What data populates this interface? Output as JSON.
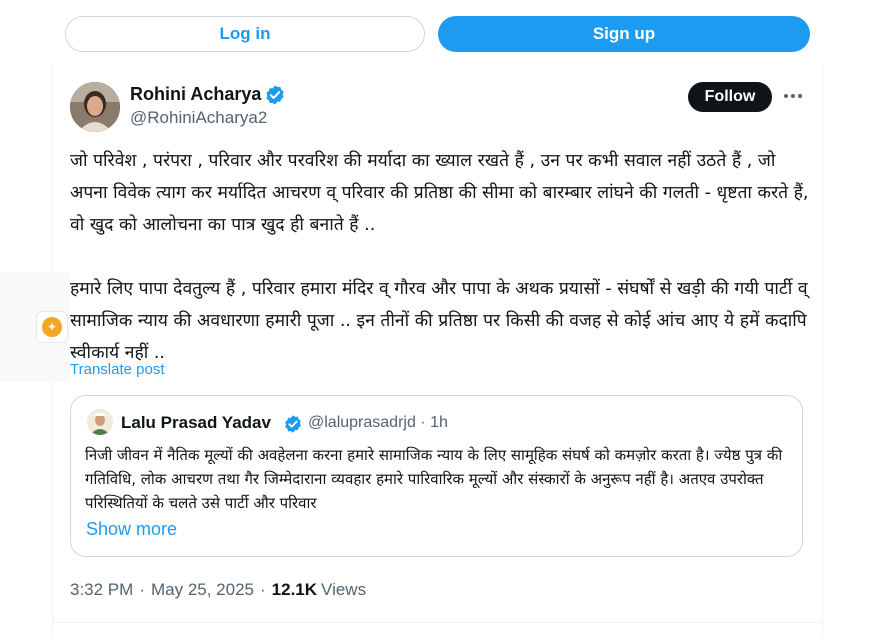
{
  "auth": {
    "login_label": "Log in",
    "signup_label": "Sign up"
  },
  "tweet": {
    "author_name": "Rohini Acharya",
    "author_handle": "@RohiniAcharya2",
    "follow_label": "Follow",
    "more_icon": "more-horizontal-icon",
    "text_para1": "जो परिवेश , परंपरा , परिवार और परवरिश की मर्यादा का ख्याल रखते हैं , उन पर कभी सवाल नहीं उठते हैं , जो अपना विवेक त्याग कर मर्यादित आचरण व् परिवार की प्रतिष्ठा की सीमा को बारम्बार लांघने की गलती - धृष्टता करते हैं, वो खुद को आलोचना का पात्र खुद ही बनाते हैं ..",
    "text_para2": "हमारे लिए पापा देवतुल्य हैं , परिवार हमारा मंदिर व् गौरव और पापा के अथक प्रयासों - संघर्षों से खड़ी की गयी पार्टी व् सामाजिक न्याय की अवधारणा हमारी पूजा .. इन तीनों की प्रतिष्ठा पर किसी की वजह से कोई आंच आए ये हमें कदापि स्वीकार्य नहीं ..",
    "translate_label": "Translate post",
    "time": "3:32 PM",
    "date": "May 25, 2025",
    "separator": "·",
    "views_count": "12.1K",
    "views_label": "Views"
  },
  "quote": {
    "author_name": "Lalu Prasad Yadav",
    "author_handle": "@laluprasadrjd · 1h",
    "text": "निजी जीवन में नैतिक मूल्यों की अवहेलना करना हमारे सामाजिक न्याय के लिए सामूहिक संघर्ष को कमज़ोर करता है। ज्येष्ठ पुत्र की गतिविधि, लोक आचरण तथा गैर जिम्मेदाराना व्यवहार हमारे पारिवारिक मूल्यों और संस्कारों के अनुरूप नहीं है। अतएव उपरोक्त परिस्थितियों के चलते उसे पार्टी और परिवार",
    "show_more_label": "Show more"
  },
  "colors": {
    "accent": "#1d9bf0",
    "text_primary": "#0f1419",
    "text_secondary": "#536471",
    "border": "#cfd9de",
    "follow_bg": "#0f1419"
  }
}
